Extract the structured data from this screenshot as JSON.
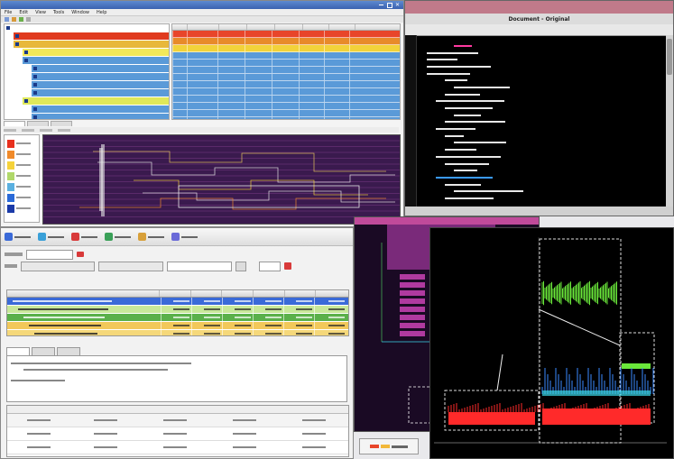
{
  "tree_window": {
    "menu": [
      "File",
      "Edit",
      "View",
      "Tools",
      "Window",
      "Help"
    ],
    "tree_rows": [
      {
        "label": "",
        "level": 0,
        "bg": "#ffffff"
      },
      {
        "label": "",
        "level": 1,
        "bg": "#e03a1e"
      },
      {
        "label": "",
        "level": 1,
        "bg": "#e8b83a"
      },
      {
        "label": "",
        "level": 2,
        "bg": "#f2e85a"
      },
      {
        "label": "",
        "level": 2,
        "bg": "#5a9ad8"
      },
      {
        "label": "",
        "level": 3,
        "bg": "#5a9ad8"
      },
      {
        "label": "",
        "level": 3,
        "bg": "#5a9ad8"
      },
      {
        "label": "",
        "level": 3,
        "bg": "#5a9ad8"
      },
      {
        "label": "",
        "level": 3,
        "bg": "#5a9ad8"
      },
      {
        "label": "",
        "level": 2,
        "bg": "#dfe85a"
      },
      {
        "label": "",
        "level": 3,
        "bg": "#5a9ad8"
      },
      {
        "label": "",
        "level": 3,
        "bg": "#5a9ad8"
      },
      {
        "label": "",
        "level": 3,
        "bg": "#5a9ad8"
      }
    ],
    "table_row_colors": [
      "#e8452a",
      "#e88a2a",
      "#f2d23a",
      "#5a9ad8",
      "#5a9ad8",
      "#5a9ad8",
      "#5a9ad8",
      "#5a9ad8",
      "#5a9ad8",
      "#5a9ad8",
      "#5a9ad8",
      "#5a9ad8",
      "#5a9ad8"
    ],
    "heat_legend_colors": [
      "#e8301e",
      "#f08a2a",
      "#f5d23a",
      "#b0d86a",
      "#5ab0e0",
      "#2a6ad8",
      "#1a3aa8"
    ]
  },
  "source_window": {
    "title": "Document - Original",
    "code_lines": [
      {
        "indent": 8,
        "color": "#ff3aa0"
      },
      {
        "indent": 2,
        "color": "#e8e8e8"
      },
      {
        "indent": 2,
        "color": "#e8e8e8"
      },
      {
        "indent": 2,
        "color": "#e8e8e8"
      },
      {
        "indent": 2,
        "color": "#e8e8e8"
      },
      {
        "indent": 6,
        "color": "#e8e8e8"
      },
      {
        "indent": 8,
        "color": "#e8e8e8"
      },
      {
        "indent": 6,
        "color": "#e8e8e8"
      },
      {
        "indent": 4,
        "color": "#e8e8e8"
      },
      {
        "indent": 6,
        "color": "#e8e8e8"
      },
      {
        "indent": 8,
        "color": "#e8e8e8"
      },
      {
        "indent": 6,
        "color": "#e8e8e8"
      },
      {
        "indent": 4,
        "color": "#e8e8e8"
      },
      {
        "indent": 6,
        "color": "#e8e8e8"
      },
      {
        "indent": 8,
        "color": "#e8e8e8"
      },
      {
        "indent": 6,
        "color": "#e8e8e8"
      },
      {
        "indent": 4,
        "color": "#e8e8e8"
      },
      {
        "indent": 6,
        "color": "#e8e8e8"
      },
      {
        "indent": 8,
        "color": "#e8e8e8"
      },
      {
        "indent": 4,
        "color": "#3a9aff"
      },
      {
        "indent": 6,
        "color": "#e8e8e8"
      },
      {
        "indent": 8,
        "color": "#e8e8e8"
      },
      {
        "indent": 6,
        "color": "#e8e8e8"
      }
    ]
  },
  "analysis_window": {
    "toolbar_colors": [
      "#3a6ad8",
      "#3aa0d8",
      "#d83a3a",
      "#3aa058",
      "#d8a03a",
      "#6a6ad8"
    ],
    "table_rows": [
      {
        "bg": "#3a6ad8",
        "fg": "#ffffff"
      },
      {
        "bg": "#c8e89a",
        "fg": "#222222"
      },
      {
        "bg": "#5ab04a",
        "fg": "#ffffff"
      },
      {
        "bg": "#f2c85a",
        "fg": "#222222"
      },
      {
        "bg": "#f5d87a",
        "fg": "#222222"
      }
    ],
    "tabs": [
      "",
      "",
      ""
    ],
    "summary_row_count": 2
  },
  "trace_window": {
    "series_colors": {
      "green": "#6ae83a",
      "blue": "#3a8aff",
      "red": "#ff2a2a",
      "cyan": "#3ad8e8"
    }
  }
}
